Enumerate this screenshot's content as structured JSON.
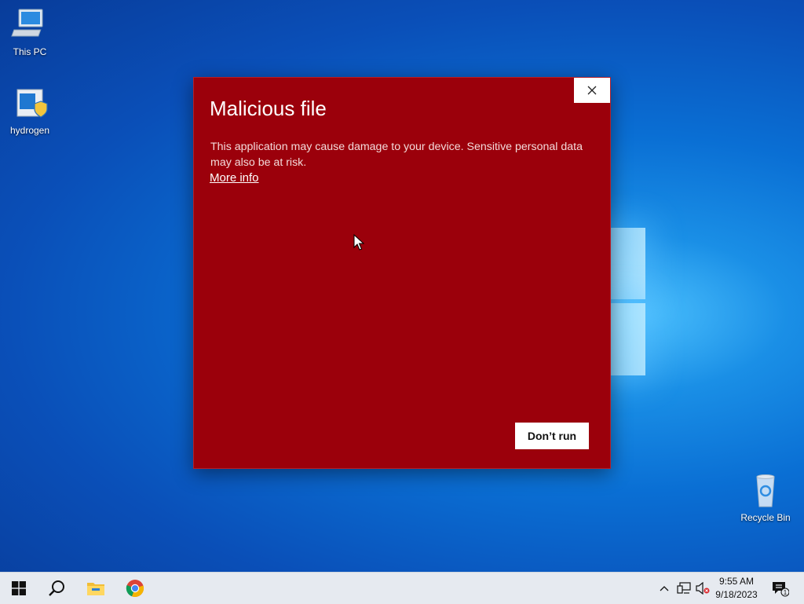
{
  "desktop": {
    "icons": [
      {
        "label": "This PC"
      },
      {
        "label": "hydrogen"
      },
      {
        "label": "Recycle Bin"
      }
    ]
  },
  "dialog": {
    "title": "Malicious file",
    "message": "This application may cause damage to your device. Sensitive personal data may also be at risk.",
    "more_info": "More info",
    "dont_run_label": "Don’t run",
    "close_icon": "close-icon",
    "background_color": "#9b000b"
  },
  "taskbar": {
    "items": [
      "windows-start-icon",
      "search-icon",
      "file-explorer-icon",
      "chrome-icon"
    ],
    "tray": {
      "time": "9:55 AM",
      "date": "9/18/2023",
      "notification_count": "1"
    }
  }
}
